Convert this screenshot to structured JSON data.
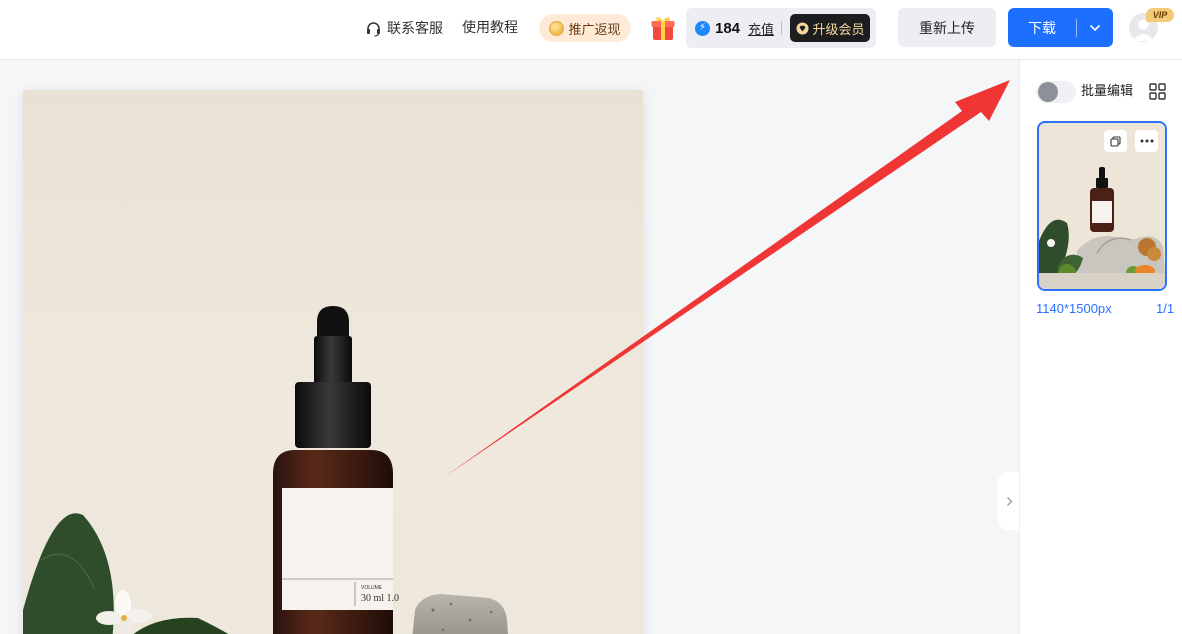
{
  "header": {
    "customer_service": "联系客服",
    "tutorial": "使用教程",
    "promo": "推广返现",
    "points": "184",
    "recharge": "充值",
    "upgrade_vip": "升级会员",
    "reupload": "重新上传",
    "download": "下载",
    "vip_badge": "VIP"
  },
  "panel": {
    "batch_edit": "批量编辑",
    "image_size": "1140*1500px",
    "page_count": "1/1"
  },
  "product": {
    "bottle_label_volume": "30 ml 1.0",
    "bottle_label_top": "VOLUME"
  },
  "colors": {
    "accent": "#1d6fff",
    "selection": "#2a72ff",
    "arrow": "#f03535"
  },
  "icons": [
    "headset-icon",
    "coin-icon",
    "gift-icon",
    "lightning-icon",
    "diamond-icon",
    "chevron-down-icon",
    "user-icon",
    "grid-icon",
    "copy-icon",
    "more-icon",
    "chevron-right-icon"
  ]
}
